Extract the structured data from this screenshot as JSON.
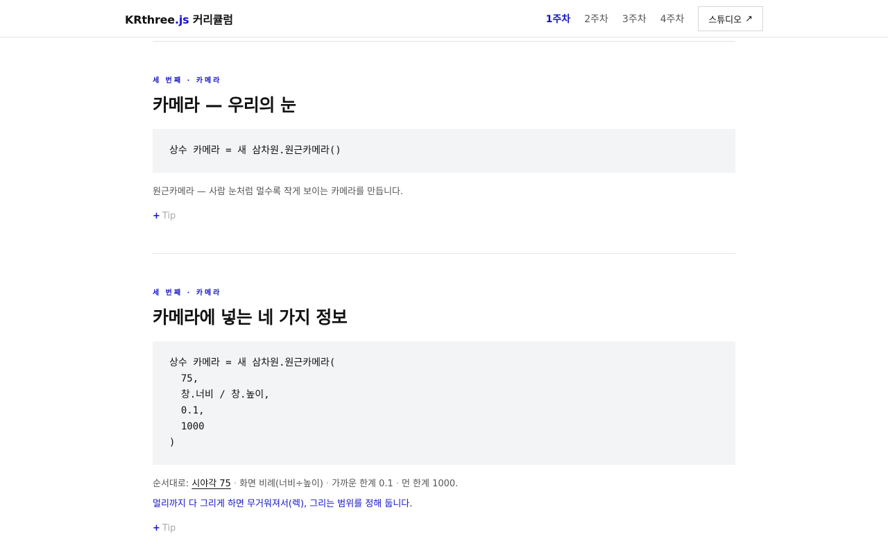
{
  "header": {
    "brand_main": "KRthree",
    "brand_js": ".js",
    "brand_suffix": " 커리큘럼",
    "nav": [
      {
        "label": "1주차",
        "active": true
      },
      {
        "label": "2주차",
        "active": false
      },
      {
        "label": "3주차",
        "active": false
      },
      {
        "label": "4주차",
        "active": false
      }
    ],
    "studio_label": "스튜디오",
    "studio_arrow": "↗"
  },
  "sections": [
    {
      "eyebrow": "세 번째 · 카메라",
      "title": "카메라 — 우리의 눈",
      "code": "상수 카메라 = 새 삼차원.원근카메라()",
      "desc": "원근카메라 — 사람 눈처럼 멀수록 작게 보이는 카메라를 만듭니다.",
      "tip_plus": "+",
      "tip_label": "Tip"
    },
    {
      "eyebrow": "세 번째 · 카메라",
      "title": "카메라에 넣는 네 가지 정보",
      "code": "상수 카메라 = 새 삼차원.원근카메라(\n  75,\n  창.너비 / 창.높이,\n  0.1,\n  1000\n)",
      "desc_prefix": "순서대로: ",
      "desc_highlight": "시야각 75",
      "desc_sep": "·",
      "desc_items": [
        "화면 비례(너비÷높이)",
        "가까운 한계 0.1",
        "먼 한계 1000."
      ],
      "note": "멀리까지 다 그리게 하면 무거워져서(렉), 그리는 범위를 정해 둡니다.",
      "tip_plus": "+",
      "tip_label": "Tip"
    }
  ],
  "colors": {
    "accent": "#1414c8",
    "code_bg": "#f3f4f6",
    "divider": "#e4e4e4"
  }
}
